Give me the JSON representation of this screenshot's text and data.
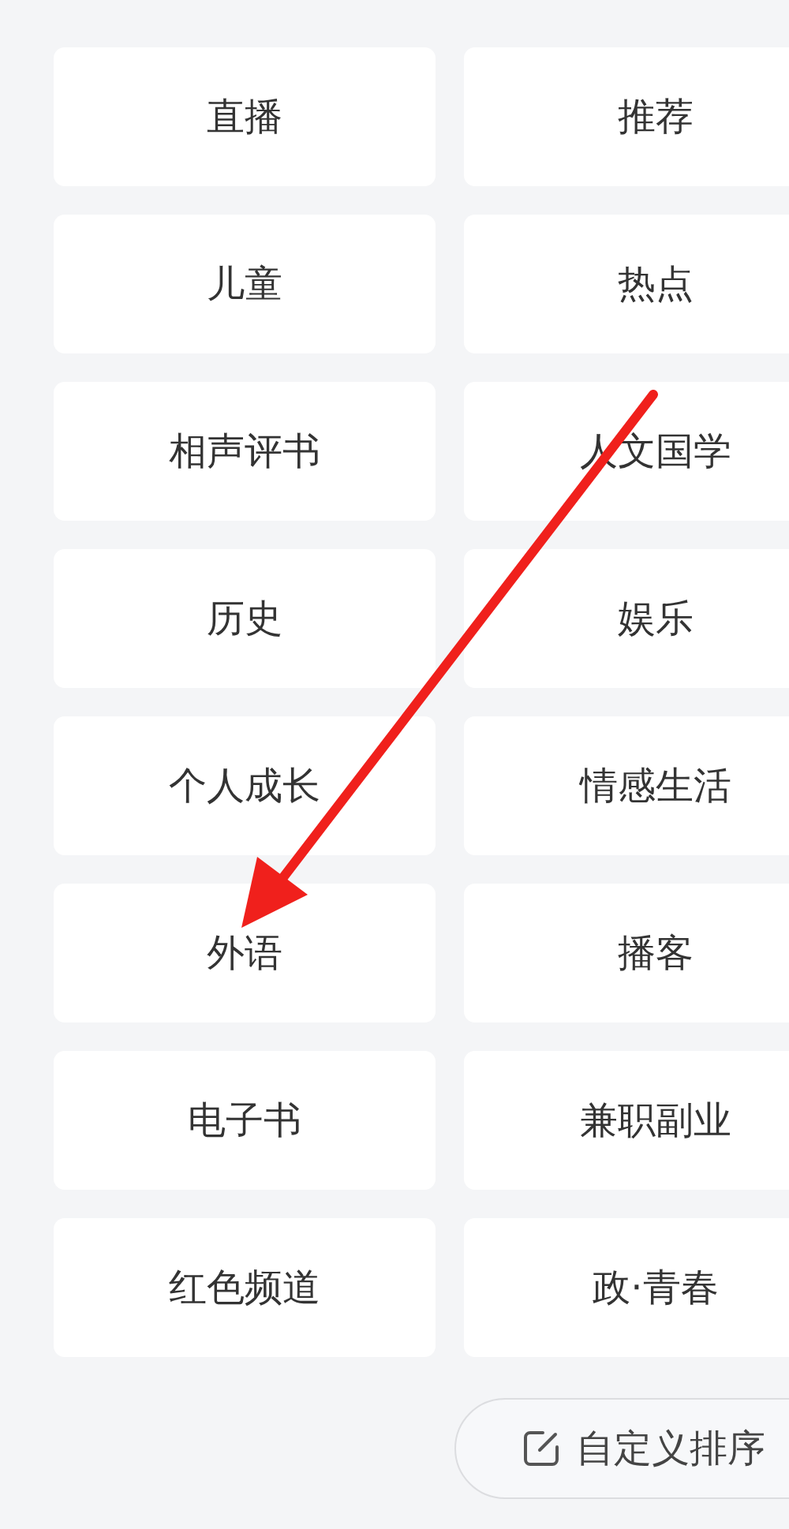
{
  "categories": [
    {
      "label": "直播"
    },
    {
      "label": "推荐"
    },
    {
      "label": "儿童"
    },
    {
      "label": "热点"
    },
    {
      "label": "相声评书"
    },
    {
      "label": "人文国学"
    },
    {
      "label": "历史"
    },
    {
      "label": "娱乐"
    },
    {
      "label": "个人成长"
    },
    {
      "label": "情感生活"
    },
    {
      "label": "外语"
    },
    {
      "label": "播客"
    },
    {
      "label": "电子书"
    },
    {
      "label": "兼职副业"
    },
    {
      "label": "红色频道"
    },
    {
      "label": "政·青春"
    }
  ],
  "sort_button": {
    "label": "自定义排序"
  }
}
